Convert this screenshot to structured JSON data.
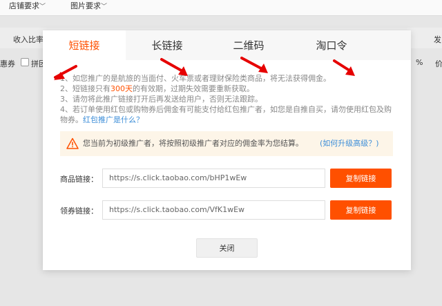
{
  "background": {
    "filters": [
      "店铺要求",
      "图片要求"
    ],
    "header_text_left": "收入比率",
    "header_text_right": "发",
    "row_text_left": "惠券",
    "row_text_mid": "拼团",
    "row_text_right1": "%",
    "row_text_right2": "价"
  },
  "modal": {
    "tabs": [
      "短链接",
      "长链接",
      "二维码",
      "淘口令"
    ],
    "active_tab": "短链接",
    "notes": {
      "line1": "1、如您推广的是航旅的当面付、火车票或者理财保险类商品，将无法获得佣金。",
      "line2_pre": "2、短链接只有",
      "line2_hl": "300天",
      "line2_post": "的有效期，过期失效需要重新获取。",
      "line3": "3、请勿将此推广链接打开后再发送给用户，否则无法跟踪。",
      "line4": "4、若订单使用红包或购物券后佣金有可能支付给红包推广者，如您是自推自买，请勿使用红包及购物券。",
      "line4_link": "红包推广是什么？"
    },
    "warning": {
      "text": "您当前为初级推广者，将按照初级推广者对应的佣金率为您结算。",
      "link": "(如何升级高级？)"
    },
    "product_link": {
      "label": "商品链接：",
      "value": "https://s.click.taobao.com/bHP1wEw",
      "button": "复制链接"
    },
    "coupon_link": {
      "label": "领券链接：",
      "value": "https://s.click.taobao.com/VfK1wEw",
      "button": "复制链接"
    },
    "close_button": "关闭"
  },
  "colors": {
    "accent": "#ff5000",
    "link": "#3d8ed8",
    "warning_bg": "#fdf5e8",
    "annotation_arrow": "#e60000"
  }
}
